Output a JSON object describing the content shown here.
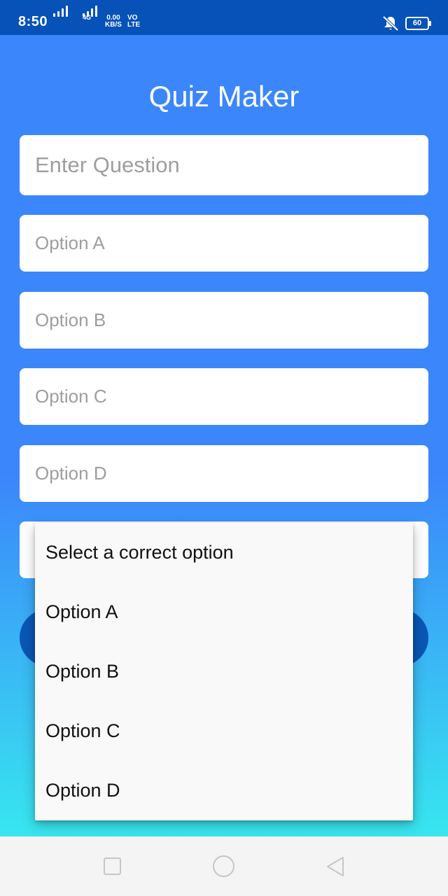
{
  "status_bar": {
    "time": "8:50",
    "network_type": "4G",
    "speed_value": "0.00",
    "speed_unit": "KB/S",
    "volte_top": "VO",
    "volte_bottom": "LTE",
    "battery": "60",
    "mute_icon": "bell-muted-icon"
  },
  "app": {
    "title": "Quiz Maker"
  },
  "form": {
    "question_placeholder": "Enter Question",
    "option_a_placeholder": "Option A",
    "option_b_placeholder": "Option B",
    "option_c_placeholder": "Option C",
    "option_d_placeholder": "Option D"
  },
  "dropdown": {
    "items": [
      {
        "label": "Select a correct option"
      },
      {
        "label": "Option A"
      },
      {
        "label": "Option B"
      },
      {
        "label": "Option C"
      },
      {
        "label": "Option D"
      }
    ]
  },
  "colors": {
    "status_bar": "#0652b8",
    "gradient_top": "#3b86fb",
    "gradient_bottom": "#38e6ef",
    "button": "#0a57b5",
    "placeholder": "#9e9e9e"
  },
  "nav_bar": {
    "recent_icon": "square-icon",
    "home_icon": "circle-icon",
    "back_icon": "triangle-back-icon"
  }
}
